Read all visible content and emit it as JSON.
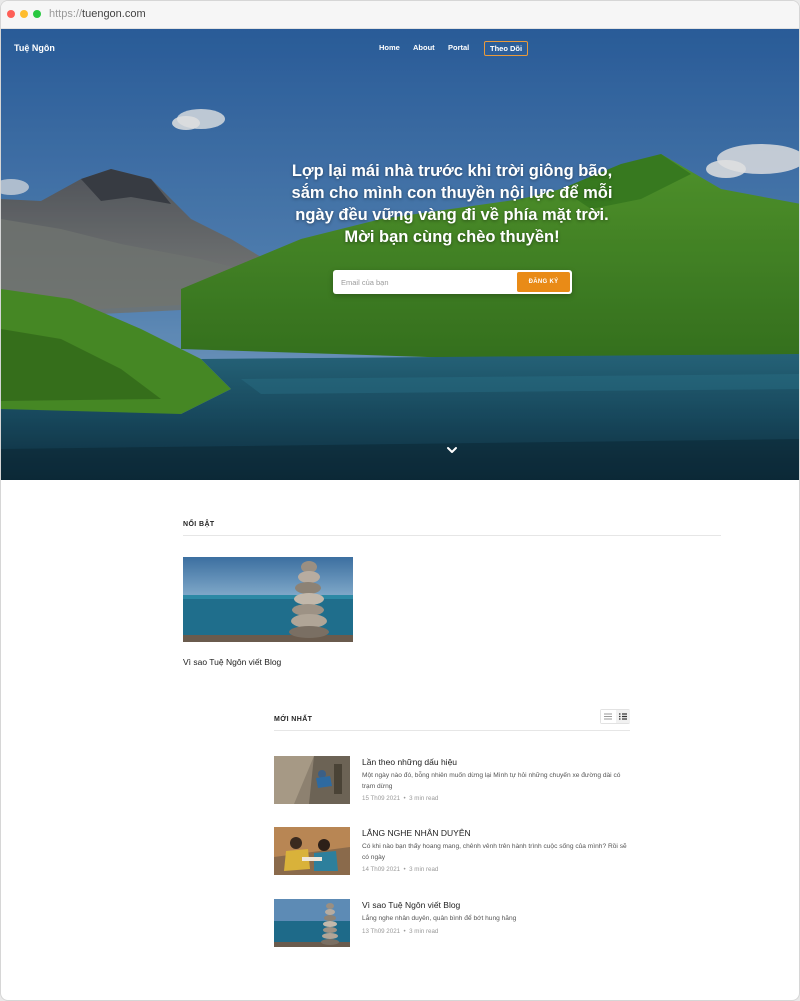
{
  "browser": {
    "url_protocol": "https://",
    "url_host": "tuengon.com"
  },
  "site": {
    "title": "Tuệ Ngôn"
  },
  "nav": {
    "home": "Home",
    "about": "About",
    "portal": "Portal",
    "follow": "Theo Dõi"
  },
  "hero": {
    "line1": "Lợp lại mái nhà trước khi trời giông bão,",
    "line2": "sắm cho mình con thuyền nội lực để mỗi",
    "line3": "ngày đều vững vàng đi về phía mặt trời.",
    "line4": "Mời bạn cùng chèo thuyền!",
    "email_placeholder": "Email của bạn",
    "subscribe_label": "ĐĂNG KÝ"
  },
  "featured": {
    "label": "NỔI BẬT",
    "post_title": "Vì sao Tuệ Ngôn viết Blog"
  },
  "latest": {
    "label": "MỚI NHẤT",
    "posts": [
      {
        "title": "Lần theo những dấu hiệu",
        "excerpt": "Một ngày nào đó, bỗng nhiên muốn dừng lại Mình tự hỏi những chuyến xe đường dài có trạm dừng",
        "date": "15 Th09 2021",
        "read": "3 min read"
      },
      {
        "title": "LẮNG NGHE NHÂN DUYÊN",
        "excerpt": "Có khi nào bạn thấy hoang mang, chênh vênh trên hành trình cuộc sống của mình? Rồi sẽ có ngày",
        "date": "14 Th09 2021",
        "read": "3 min read"
      },
      {
        "title": "Vì sao Tuệ Ngôn viết Blog",
        "excerpt": "Lắng nghe nhân duyên, quân bình để bớt hung hăng",
        "date": "13 Th09 2021",
        "read": "3 min read"
      }
    ]
  },
  "icons": {
    "scroll": "chevron-down-icon",
    "list_view": "list-view-icon",
    "grid_view": "grid-view-icon"
  },
  "colors": {
    "accent": "#e98b17",
    "sky": "#3d78b8",
    "lake": "#1d5f78",
    "meadow": "#4e9a2a"
  }
}
